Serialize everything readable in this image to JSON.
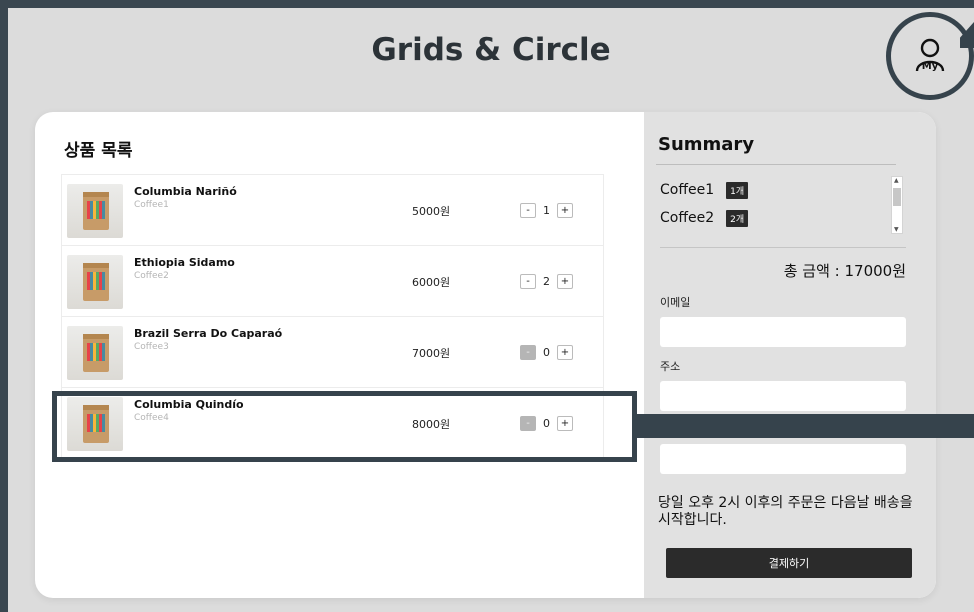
{
  "header": {
    "title": "Grids & Circle",
    "my_label": "My"
  },
  "product_list": {
    "title": "상품 목록",
    "items": [
      {
        "name": "Columbia Nariñó",
        "sub": "Coffee1",
        "price": "5000원",
        "qty": "1",
        "minus": "-",
        "plus": "+"
      },
      {
        "name": "Ethiopia Sidamo",
        "sub": "Coffee2",
        "price": "6000원",
        "qty": "2",
        "minus": "-",
        "plus": "+"
      },
      {
        "name": "Brazil Serra Do Caparaó",
        "sub": "Coffee3",
        "price": "7000원",
        "qty": "0",
        "minus": "-",
        "plus": "+"
      },
      {
        "name": "Columbia Quindío",
        "sub": "Coffee4",
        "price": "8000원",
        "qty": "0",
        "minus": "-",
        "plus": "+"
      }
    ]
  },
  "summary": {
    "title": "Summary",
    "items": [
      {
        "name": "Coffee1",
        "count": "1개"
      },
      {
        "name": "Coffee2",
        "count": "2개"
      }
    ],
    "total": "총 금액 : 17000원",
    "email_label": "이메일",
    "email_value": "",
    "address_label": "주소",
    "address_value": "",
    "postcode_value": "",
    "notice": "당일 오후 2시 이후의 주문은 다음날 배송을 시작합니다.",
    "pay_label": "결제하기"
  },
  "colors": {
    "accent": "#36434c",
    "panel": "#e1e1e1",
    "button": "#2b2b2b"
  }
}
